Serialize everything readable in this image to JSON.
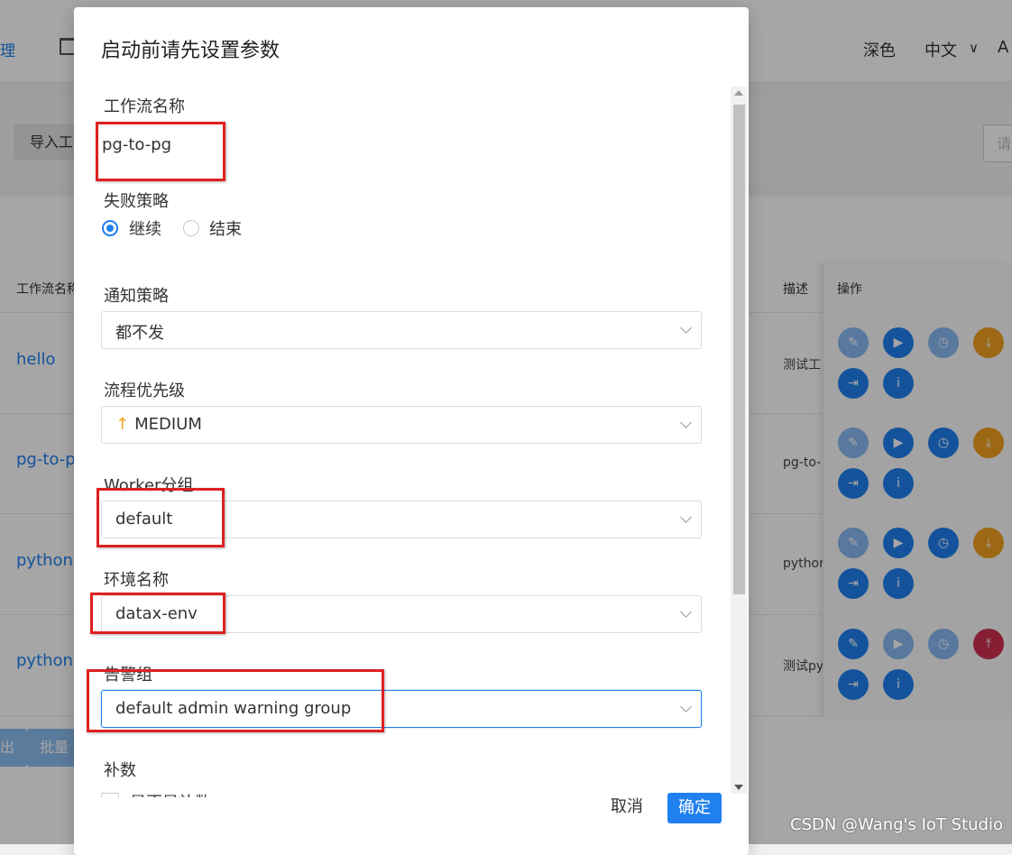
{
  "background": {
    "nav_partial": "理",
    "theme_label": "深色",
    "language_label": "中文",
    "user_partial": "A",
    "import_button_partial": "导入工",
    "search_partial": "请",
    "columns": {
      "name": "工作流名称",
      "description": "描述",
      "operations": "操作"
    },
    "rows": [
      {
        "name": "hello",
        "description": "测试工"
      },
      {
        "name": "pg-to-p",
        "description": "pg-to-"
      },
      {
        "name": "python-",
        "description": "pythor"
      },
      {
        "name": "python-",
        "description": "测试py"
      }
    ],
    "batch_left_partial": "出",
    "batch_button_partial": "批量"
  },
  "modal": {
    "title": "启动前请先设置参数",
    "workflow_name_label": "工作流名称",
    "workflow_name_value": "pg-to-pg",
    "failure_strategy_label": "失败策略",
    "failure_options": [
      "继续",
      "结束"
    ],
    "failure_selected": "继续",
    "notify_label": "通知策略",
    "notify_value": "都不发",
    "priority_label": "流程优先级",
    "priority_value": "MEDIUM",
    "priority_icon": "arrow-up-icon",
    "worker_group_label": "Worker分组",
    "worker_group_value": "default",
    "environment_label": "环境名称",
    "environment_value": "datax-env",
    "alert_group_label": "告警组",
    "alert_group_value": "default admin warning group",
    "complement_label": "补数",
    "complement_checkbox_label": "是否是补数",
    "cancel": "取消",
    "confirm": "确定"
  },
  "watermark": "CSDN @Wang's IoT Studio",
  "colors": {
    "primary": "#2080f0",
    "warning": "#f0a020",
    "error": "#d03050",
    "highlight": "#e02020"
  }
}
